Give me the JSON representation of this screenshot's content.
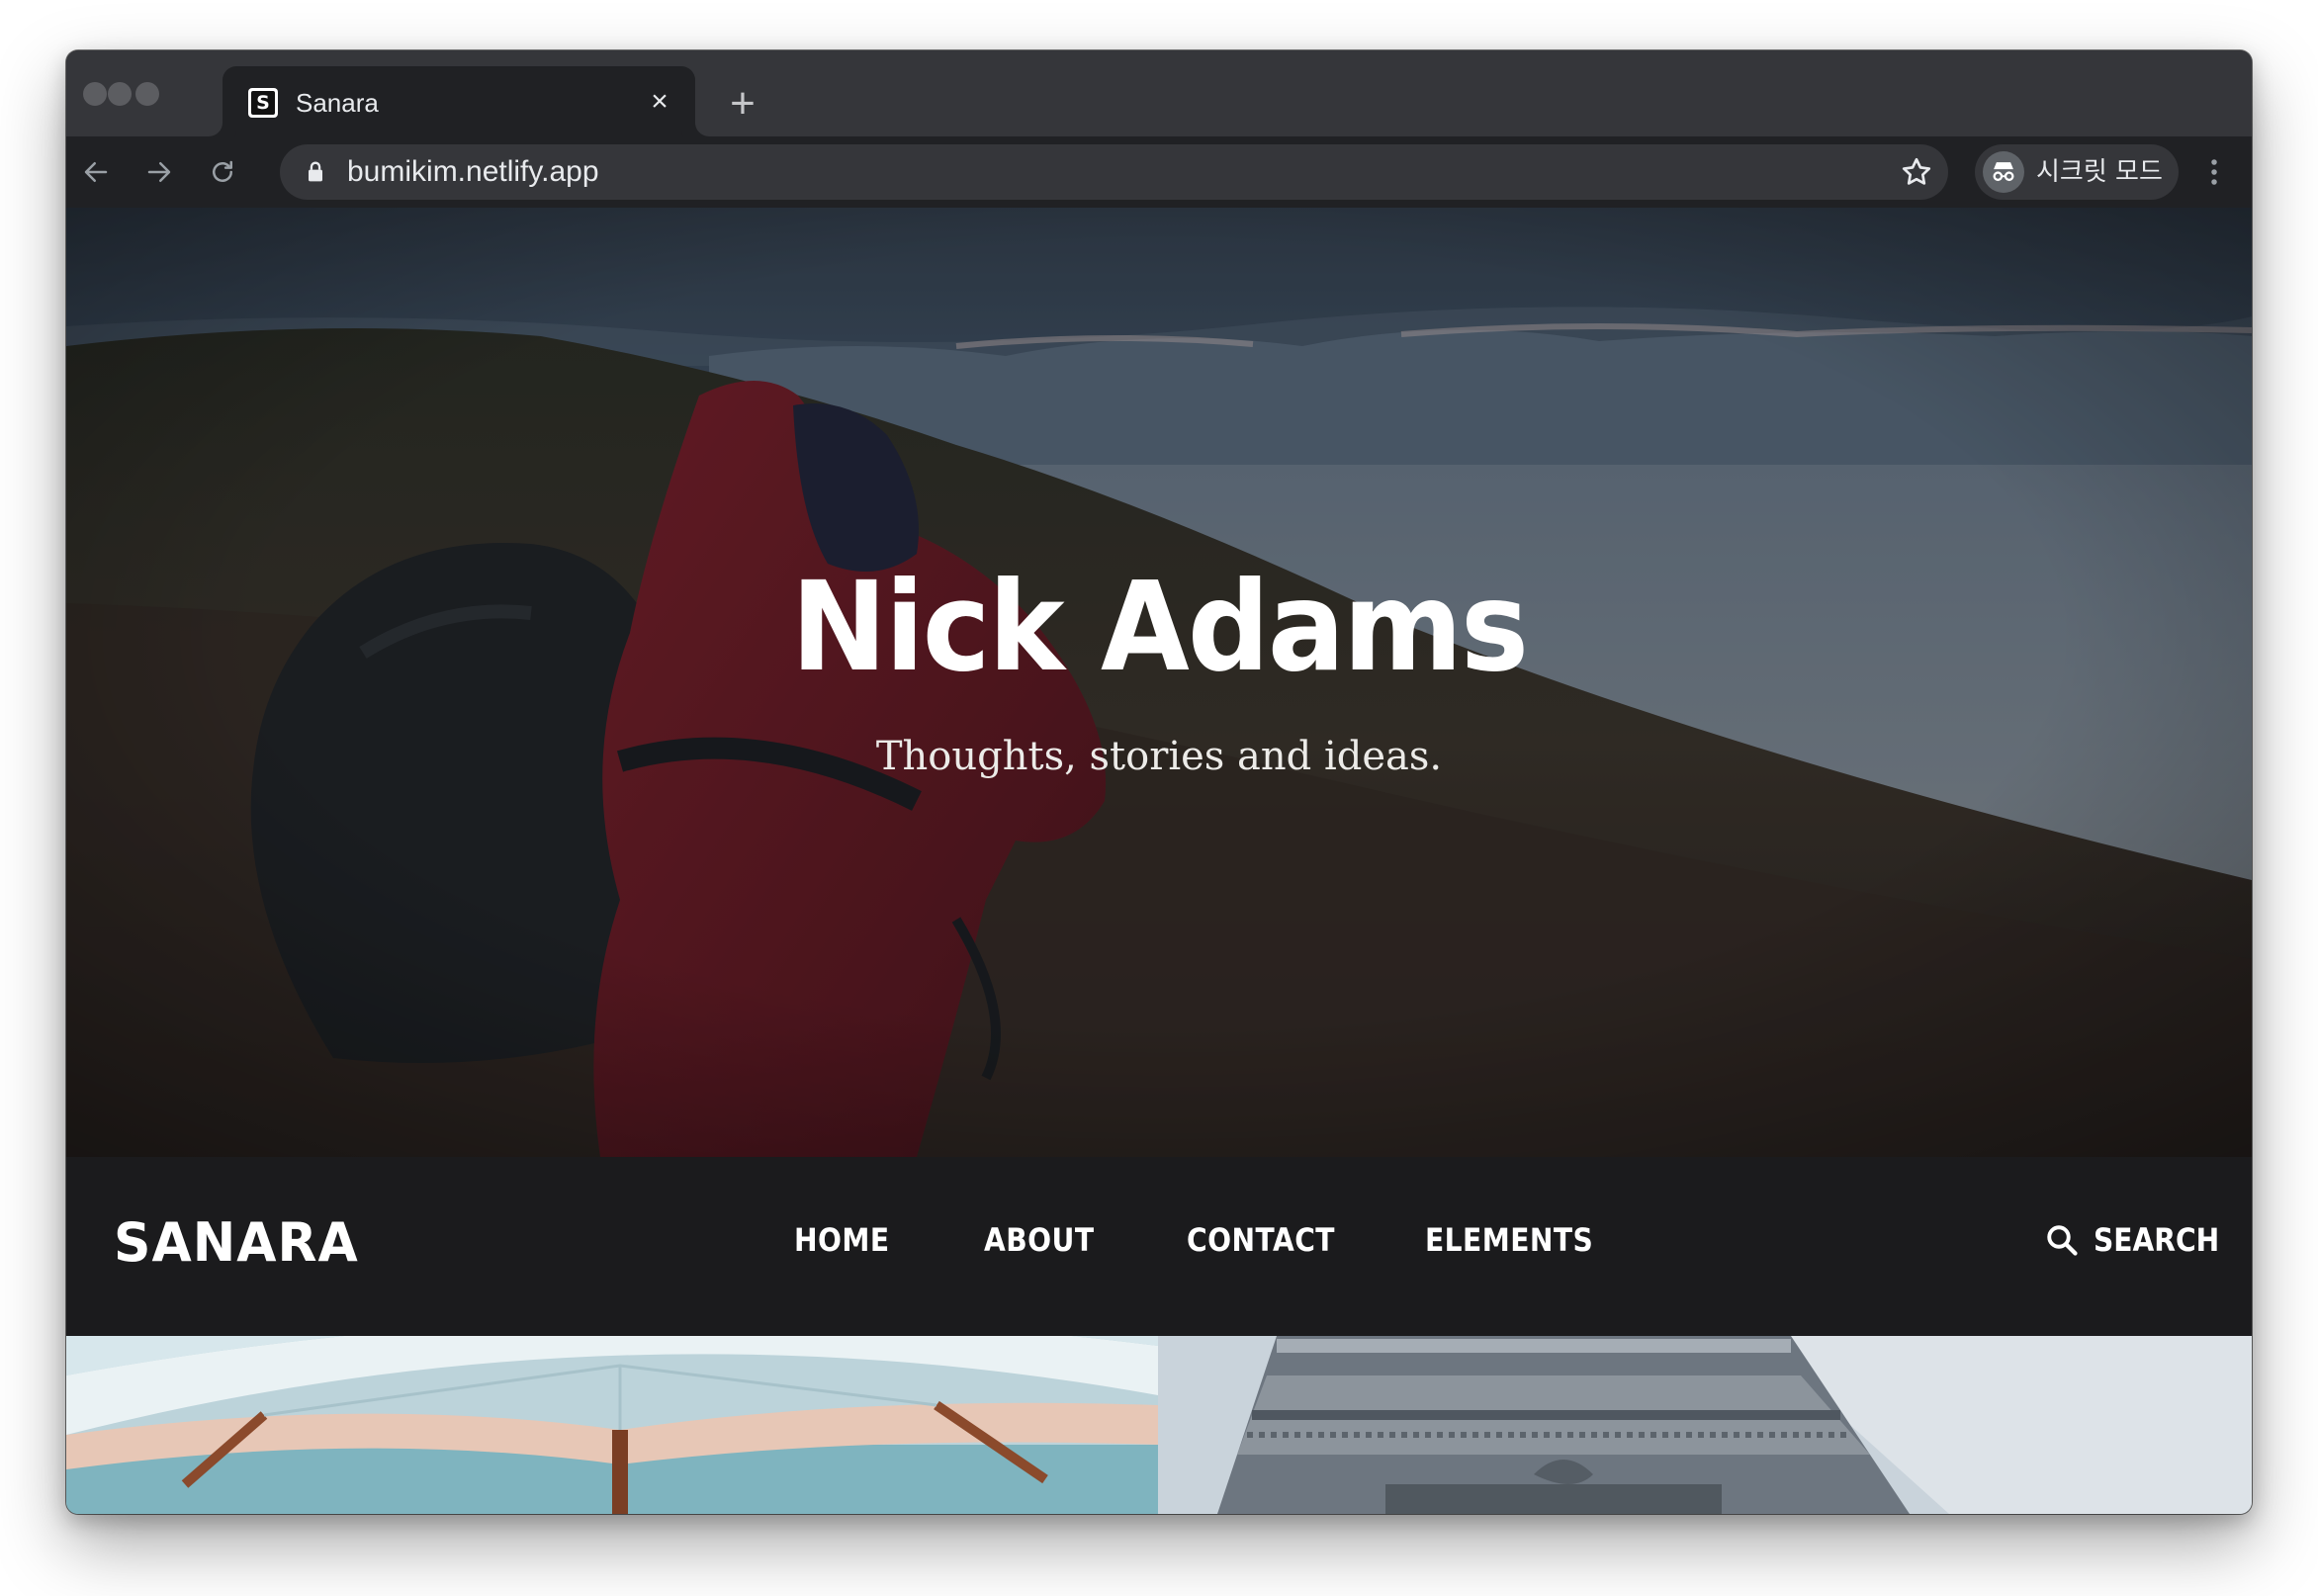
{
  "browser": {
    "tab": {
      "favicon_letter": "S",
      "title": "Sanara",
      "close_glyph": "×"
    },
    "new_tab_glyph": "+",
    "url": "bumikim.netlify.app",
    "incognito_label": "시크릿 모드",
    "icons": {
      "back": "arrow-left-icon",
      "forward": "arrow-right-icon",
      "reload": "reload-icon",
      "lock": "lock-icon",
      "bookmark": "star-icon",
      "incognito": "incognito-icon",
      "menu": "kebab-menu-icon"
    },
    "colors": {
      "tabstrip": "#35363a",
      "toolbar": "#202124",
      "omnibox": "#35363a"
    }
  },
  "hero": {
    "title": "Nick Adams",
    "subtitle": "Thoughts, stories and ideas."
  },
  "site_nav": {
    "logo": "SANARA",
    "menu": [
      {
        "label": "HOME"
      },
      {
        "label": "ABOUT"
      },
      {
        "label": "CONTACT"
      },
      {
        "label": "ELEMENTS"
      }
    ],
    "search_label": "SEARCH",
    "search_icon": "search-icon",
    "background": "#1b1b1d"
  },
  "posts": [
    {
      "image": "umbrella-photo"
    },
    {
      "image": "monument-photo"
    }
  ]
}
